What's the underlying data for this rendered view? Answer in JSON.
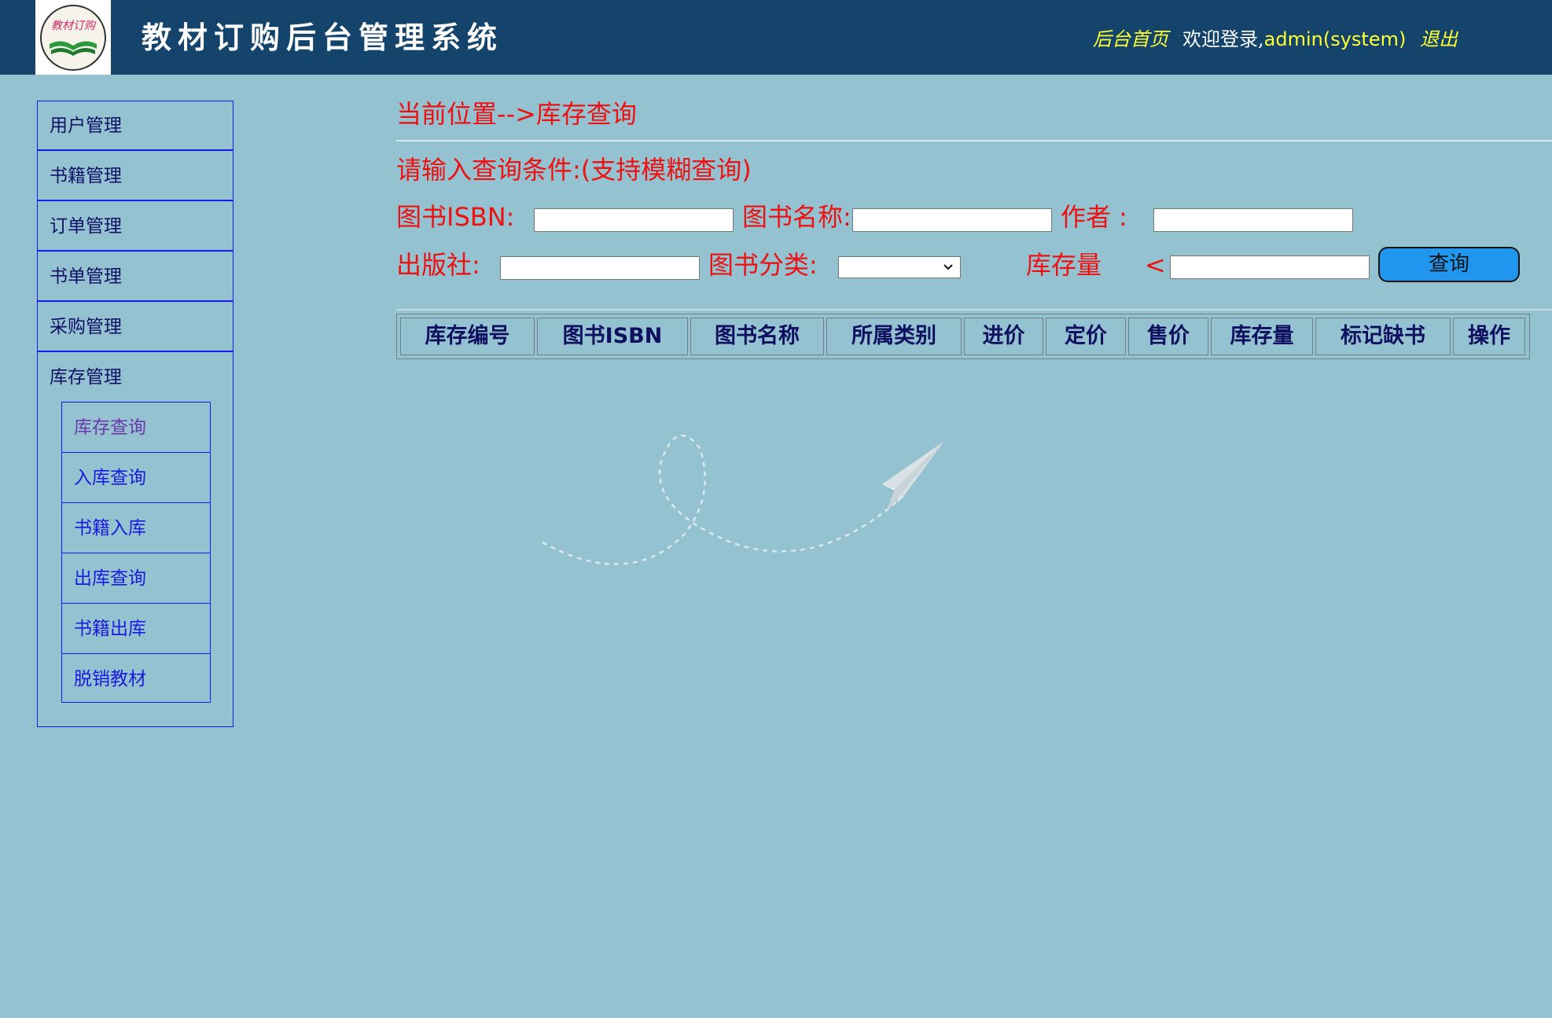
{
  "header": {
    "title": "教材订购后台管理系统",
    "logo_text": "教材订购",
    "home_link": "后台首页",
    "welcome": "欢迎登录,",
    "user": "admin(system)",
    "logout": "退出"
  },
  "sidebar": {
    "items": [
      "用户管理",
      "书籍管理",
      "订单管理",
      "书单管理",
      "采购管理",
      "库存管理"
    ],
    "sub_items": [
      "库存查询",
      "入库查询",
      "书籍入库",
      "出库查询",
      "书籍出库",
      "脱销教材"
    ],
    "active_sub": "库存查询"
  },
  "main": {
    "breadcrumb": "当前位置-->库存查询",
    "hint": "请输入查询条件:(支持模糊查询)",
    "labels": {
      "isbn": "图书ISBN:",
      "name": "图书名称:",
      "author": "作者 :",
      "publisher": "出版社:",
      "category": "图书分类:",
      "stock": "库存量",
      "lt": "<"
    },
    "inputs": {
      "isbn": "",
      "name": "",
      "author": "",
      "publisher": "",
      "stock": ""
    },
    "category_selected": "",
    "query_button": "查询",
    "table_headers": [
      "库存编号",
      "图书ISBN",
      "图书名称",
      "所属类别",
      "进价",
      "定价",
      "售价",
      "库存量",
      "标记缺书",
      "操作"
    ]
  },
  "colors": {
    "header_bg": "#14446b",
    "page_bg": "#94c2d0",
    "label_red": "#ee1111",
    "link_yellow": "#ffff33",
    "menu_border": "#1a1aee",
    "button_blue": "#2196ef"
  }
}
